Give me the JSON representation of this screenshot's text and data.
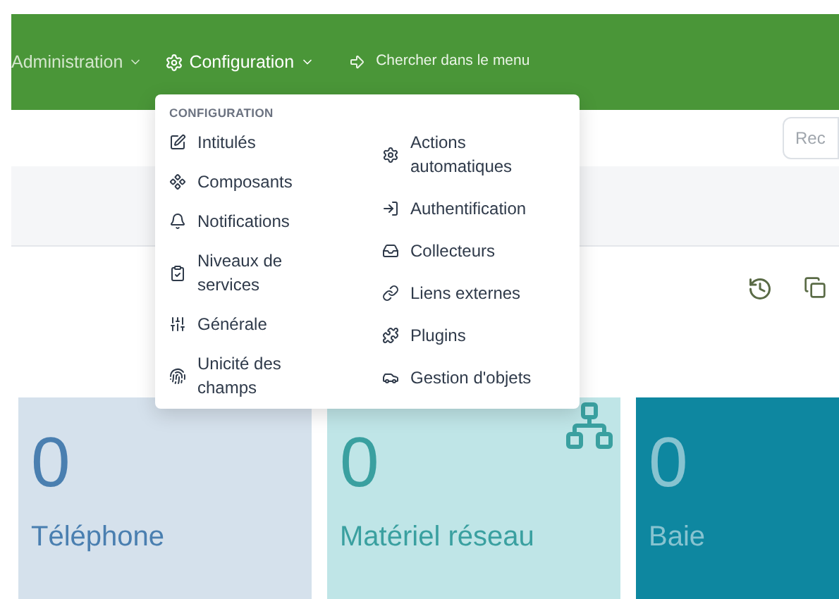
{
  "nav": {
    "items": [
      {
        "label": "Administration",
        "selected": false
      },
      {
        "label": "Configuration",
        "selected": true
      }
    ],
    "menu_search": "Chercher dans le menu"
  },
  "search": {
    "placeholder": "Rec"
  },
  "dropdown": {
    "heading": "CONFIGURATION",
    "columns": [
      [
        {
          "label": "Intitulés"
        },
        {
          "label": "Composants"
        },
        {
          "label": "Notifications"
        },
        {
          "label": "Niveaux de services"
        },
        {
          "label": "Générale"
        },
        {
          "label": "Unicité des champs"
        }
      ],
      [
        {
          "label": "Actions automatiques"
        },
        {
          "label": "Authentification"
        },
        {
          "label": "Collecteurs"
        },
        {
          "label": "Liens externes"
        },
        {
          "label": "Plugins"
        },
        {
          "label": "Gestion d'objets"
        }
      ]
    ]
  },
  "cards": [
    {
      "value": "0",
      "label": "Téléphone",
      "color": "#d5e1ec",
      "kind": "plain"
    },
    {
      "value": "0",
      "label": "Matériel réseau",
      "color": "#bfe5e7",
      "kind": "network"
    },
    {
      "value": "0",
      "label": "Baie",
      "color": "#0e87a0",
      "kind": "plain"
    }
  ]
}
